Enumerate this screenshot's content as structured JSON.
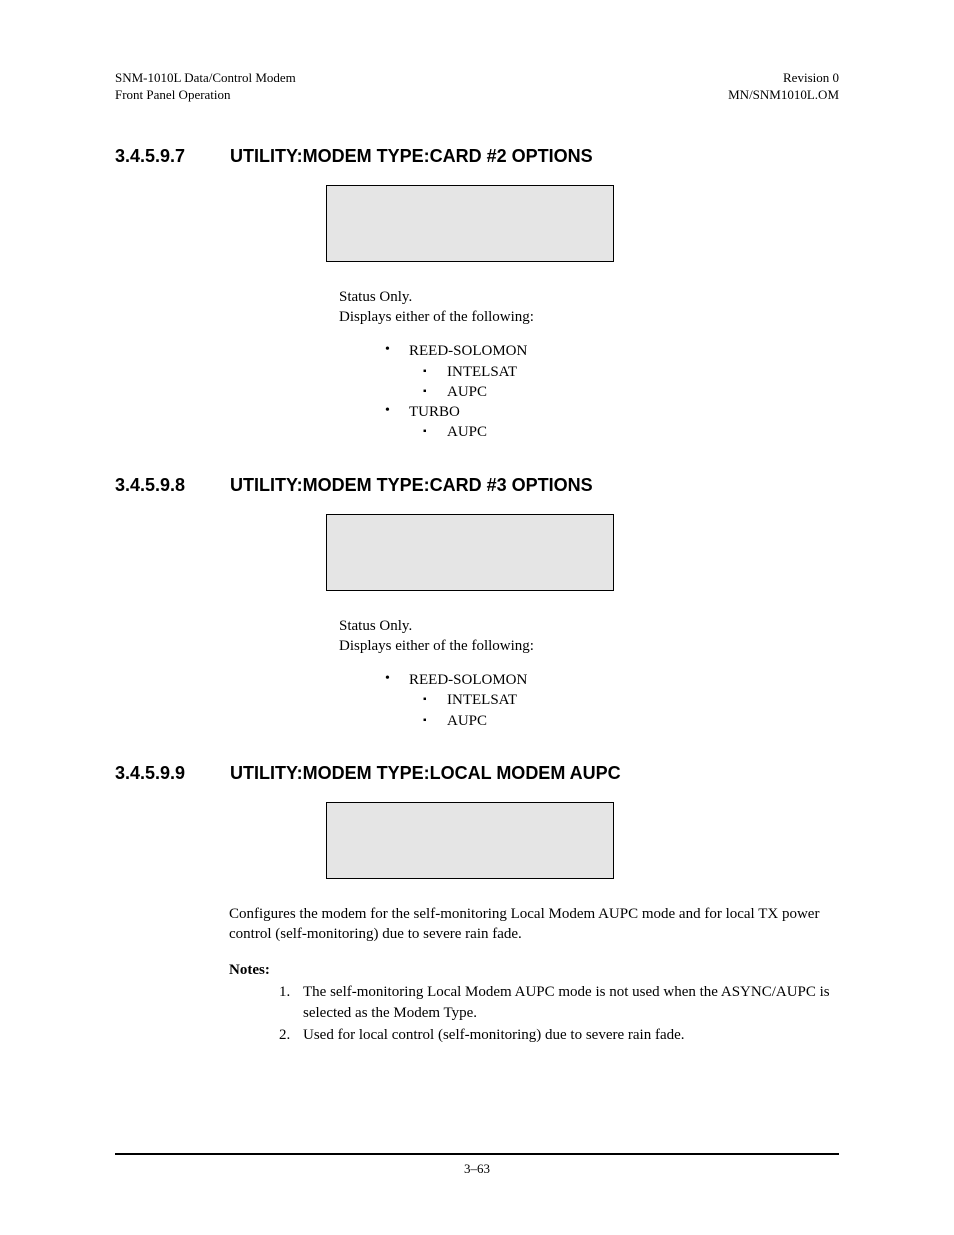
{
  "header": {
    "leftLine1": "SNM-1010L Data/Control Modem",
    "leftLine2": "Front Panel Operation",
    "rightLine1": "Revision 0",
    "rightLine2": "MN/SNM1010L.OM"
  },
  "section1": {
    "number": "3.4.5.9.7",
    "title": "UTILITY:MODEM TYPE:CARD #2 OPTIONS",
    "statusLine1": "Status Only.",
    "statusLine2": "Displays either of the following:",
    "bullets": {
      "item1": "REED-SOLOMON",
      "item1a": "INTELSAT",
      "item1b": "AUPC",
      "item2": "TURBO",
      "item2a": "AUPC"
    }
  },
  "section2": {
    "number": "3.4.5.9.8",
    "title": "UTILITY:MODEM TYPE:CARD #3 OPTIONS",
    "statusLine1": "Status Only.",
    "statusLine2": "Displays either of the following:",
    "bullets": {
      "item1": "REED-SOLOMON",
      "item1a": "INTELSAT",
      "item1b": "AUPC"
    }
  },
  "section3": {
    "number": "3.4.5.9.9",
    "title": "UTILITY:MODEM TYPE:LOCAL MODEM AUPC",
    "configText": "Configures the modem for the self-monitoring Local Modem AUPC mode and for local TX power control (self-monitoring) due to severe rain fade.",
    "notesHeading": "Notes:",
    "notes": {
      "note1num": "1.",
      "note1": "The self-monitoring Local Modem AUPC mode is not used when the ASYNC/AUPC is selected as the Modem Type.",
      "note2num": "2.",
      "note2": "Used for local control (self-monitoring) due to severe rain fade."
    }
  },
  "footer": {
    "pageNumber": "3–63"
  }
}
